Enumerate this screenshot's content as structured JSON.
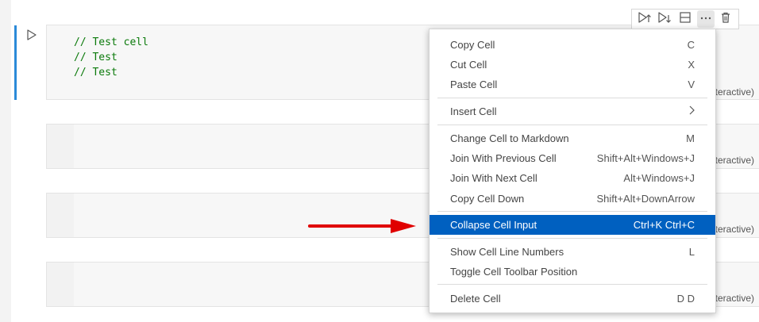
{
  "cells": [
    {
      "code": [
        "// Test cell",
        "// Test",
        "// Test"
      ],
      "kernel_tail": "teractive)"
    },
    {
      "code": [],
      "kernel_tail": "teractive)"
    },
    {
      "code": [],
      "kernel_tail": "teractive)"
    },
    {
      "code": [],
      "kernel_tail": "teractive)"
    }
  ],
  "cell_toolbar": {
    "icons": [
      "run-above-icon",
      "run-below-icon",
      "split-cell-icon",
      "more-actions-icon",
      "delete-icon"
    ]
  },
  "context_menu": {
    "groups": [
      [
        {
          "label": "Copy Cell",
          "shortcut": "C"
        },
        {
          "label": "Cut Cell",
          "shortcut": "X"
        },
        {
          "label": "Paste Cell",
          "shortcut": "V"
        }
      ],
      [
        {
          "label": "Insert Cell",
          "shortcut": ""
        }
      ],
      [
        {
          "label": "Change Cell to Markdown",
          "shortcut": "M"
        },
        {
          "label": "Join With Previous Cell",
          "shortcut": "Shift+Alt+Windows+J"
        },
        {
          "label": "Join With Next Cell",
          "shortcut": "Alt+Windows+J"
        },
        {
          "label": "Copy Cell Down",
          "shortcut": "Shift+Alt+DownArrow"
        }
      ],
      [
        {
          "label": "Collapse Cell Input",
          "shortcut": "Ctrl+K Ctrl+C"
        }
      ],
      [
        {
          "label": "Show Cell Line Numbers",
          "shortcut": "L"
        },
        {
          "label": "Toggle Cell Toolbar Position",
          "shortcut": ""
        }
      ],
      [
        {
          "label": "Delete Cell",
          "shortcut": "D D"
        }
      ]
    ],
    "selected_label": "Collapse Cell Input"
  },
  "colors": {
    "accent": "#0060c0",
    "active_cell_bar": "#2b8ad8",
    "code_comment": "#0b7a0b",
    "annotation_arrow": "#e00000"
  }
}
